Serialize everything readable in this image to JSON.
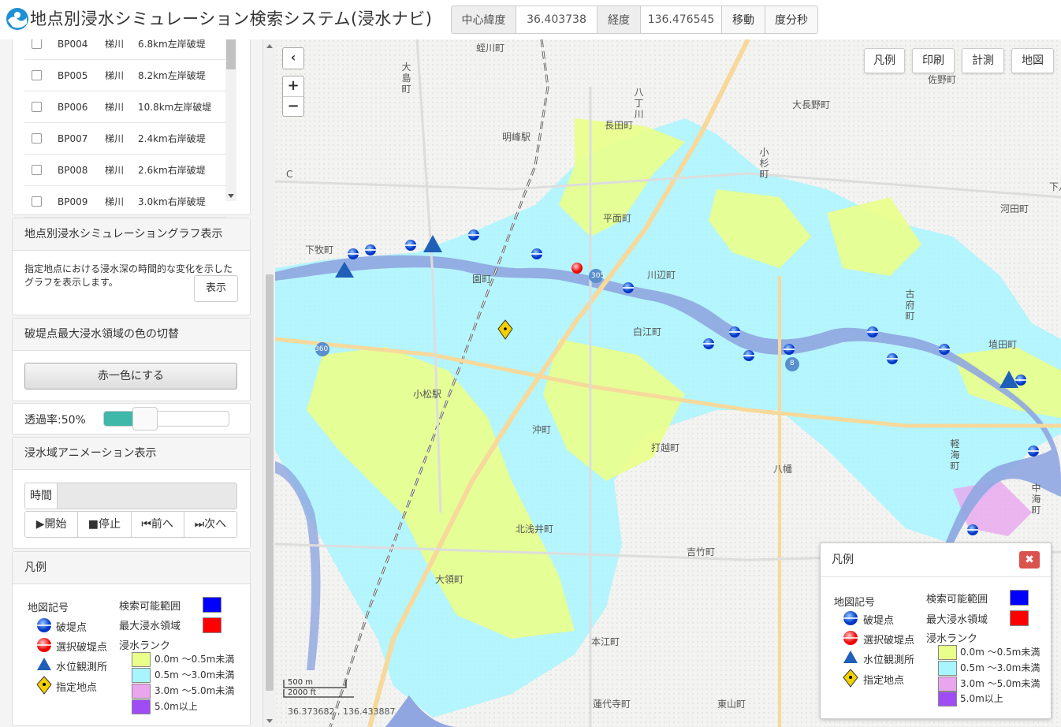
{
  "header": {
    "title": "地点別浸水シミュレーション検索システム(浸水ナビ)",
    "lat_label": "中心緯度",
    "lat_value": "36.403738",
    "lon_label": "経度",
    "lon_value": "136.476545",
    "move_btn": "移動",
    "dms_btn": "度分秒"
  },
  "breach_points": [
    {
      "code": "BP004",
      "river": "梯川",
      "desc": "6.8km左岸破堤"
    },
    {
      "code": "BP005",
      "river": "梯川",
      "desc": "8.2km左岸破堤"
    },
    {
      "code": "BP006",
      "river": "梯川",
      "desc": "10.8km左岸破堤"
    },
    {
      "code": "BP007",
      "river": "梯川",
      "desc": "2.4km右岸破堤"
    },
    {
      "code": "BP008",
      "river": "梯川",
      "desc": "2.6km右岸破堤"
    },
    {
      "code": "BP009",
      "river": "梯川",
      "desc": "3.0km右岸破堤"
    }
  ],
  "graph_panel": {
    "title": "地点別浸水シミュレーショングラフ表示",
    "desc": "指定地点における浸水深の時間的な変化を示したグラフを表示します。",
    "show_btn": "表示"
  },
  "color_panel": {
    "title": "破堤点最大浸水領域の色の切替",
    "btn": "赤一色にする"
  },
  "opacity": {
    "label": "透過率:50%",
    "value": 0.5
  },
  "anim_panel": {
    "title": "浸水域アニメーション表示",
    "time_label": "時間",
    "start": "▶開始",
    "stop": "■停止",
    "prev": "⏮前へ",
    "next": "⏭次へ"
  },
  "legend": {
    "title": "凡例",
    "map_symbols": "地図記号",
    "breach": "破堤点",
    "selected_breach": "選択破堤点",
    "gauge": "水位観測所",
    "point": "指定地点",
    "search_range": "検索可能範囲",
    "max_area": "最大浸水領域",
    "rank_title": "浸水ランク",
    "ranks": [
      "0.0m 〜0.5m未満",
      "0.5m 〜3.0m未満",
      "3.0m 〜5.0m未満",
      "5.0m以上"
    ],
    "colors": {
      "search_range": "#0000ff",
      "max_area": "#ff0000",
      "rank1": "#eaff8a",
      "rank2": "#a9f5ff",
      "rank3": "#e9a6ef",
      "rank4": "#a04cf5"
    }
  },
  "map": {
    "buttons": {
      "legend": "凡例",
      "print": "印刷",
      "measure": "計測",
      "basemap": "地図"
    },
    "zoom_in": "+",
    "zoom_out": "−",
    "collapse": "‹",
    "places": [
      "蛭川町",
      "大島町",
      "八丁川",
      "長田町",
      "大長野町",
      "佐野町",
      "明峰駅",
      "小杉町",
      "下八里",
      "河田町",
      "平面町",
      "下牧町",
      "園町",
      "川辺町",
      "古府町",
      "白江町",
      "埴田町",
      "小松駅",
      "沖町",
      "打越町",
      "八幡",
      "軽海町",
      "中海町",
      "北浅井町",
      "吉竹町",
      "大領町",
      "本江町",
      "蓮代寺町",
      "東山町"
    ],
    "road_labels": [
      "305",
      "360",
      "8"
    ],
    "scale_m": "500 m",
    "scale_ft": "2000 ft",
    "cursor_coords": "36.373682 , 136.433887",
    "edge_label": "C"
  }
}
